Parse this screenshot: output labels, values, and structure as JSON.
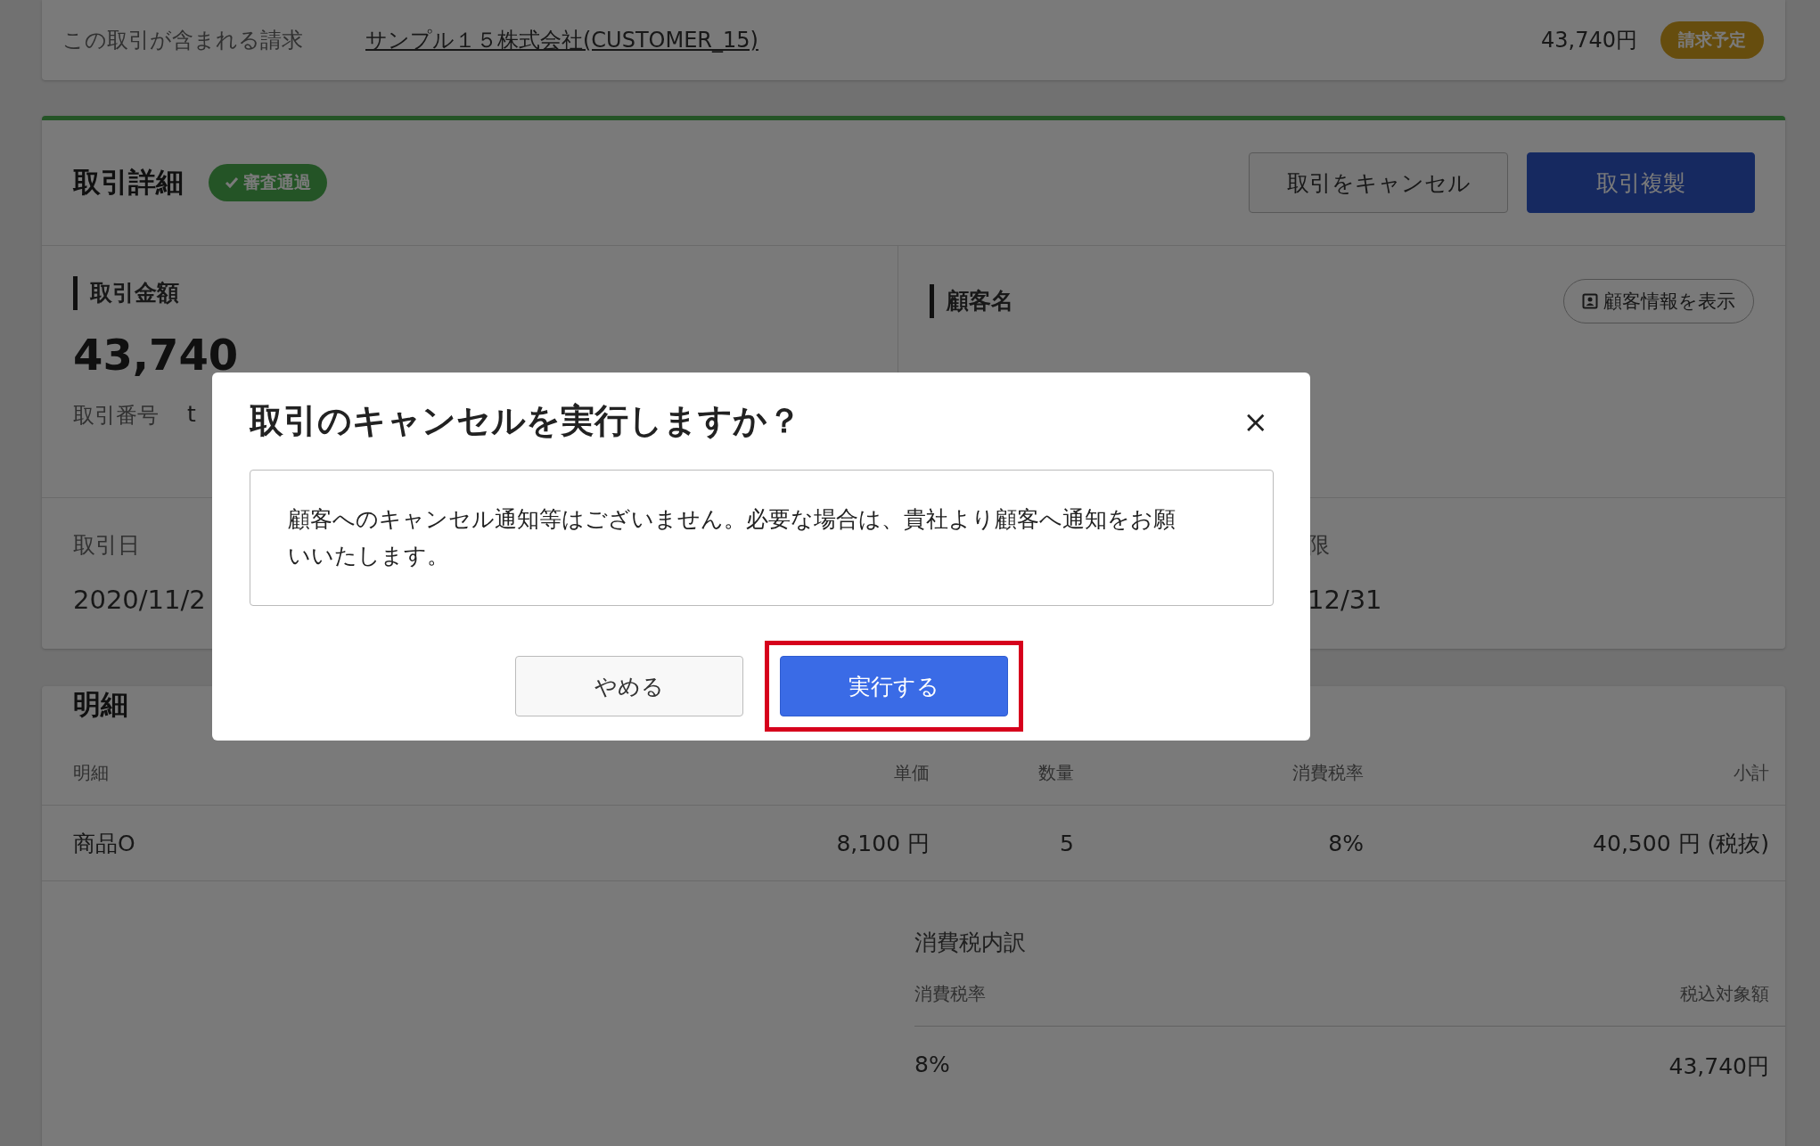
{
  "invoice_bar": {
    "label": "この取引が含まれる請求",
    "link": "サンプル１５株式会社(CUSTOMER_15)",
    "amount": "43,740円",
    "badge": "請求予定"
  },
  "transaction": {
    "title": "取引詳細",
    "status_badge": "審査通過",
    "buttons": [
      {
        "label": "取引をキャンセル",
        "kind": "secondary"
      },
      {
        "label": "取引複製",
        "kind": "primary"
      }
    ],
    "amount_section": {
      "heading": "取引金額",
      "amount": "43,740",
      "number_label": "取引番号",
      "number_value": "t"
    },
    "customer_section": {
      "heading": "顧客名",
      "button": "顧客情報を表示"
    },
    "date": {
      "label": "取引日",
      "value": "2020/11/2"
    },
    "due": {
      "label": "限",
      "value": "12/31"
    }
  },
  "line_items": {
    "title": "明細",
    "columns": [
      "明細",
      "単価",
      "数量",
      "消費税率",
      "小計"
    ],
    "rows": [
      [
        "商品O",
        "8,100 円",
        "5",
        "8%",
        "40,500 円 (税抜)"
      ]
    ],
    "tax_breakdown": {
      "title": "消費税内訳",
      "columns": [
        "消費税率",
        "税込対象額"
      ],
      "rows": [
        [
          "8%",
          "43,740円"
        ]
      ]
    }
  },
  "dialog": {
    "title": "取引のキャンセルを実行しますか？",
    "close": "×",
    "message": "顧客へのキャンセル通知等はございません。必要な場合は、貴社より顧客へ通知をお願いいたします。",
    "buttons": [
      {
        "label": "やめる",
        "kind": "secondary",
        "highlighted": false
      },
      {
        "label": "実行する",
        "kind": "primary",
        "highlighted": true
      }
    ]
  }
}
